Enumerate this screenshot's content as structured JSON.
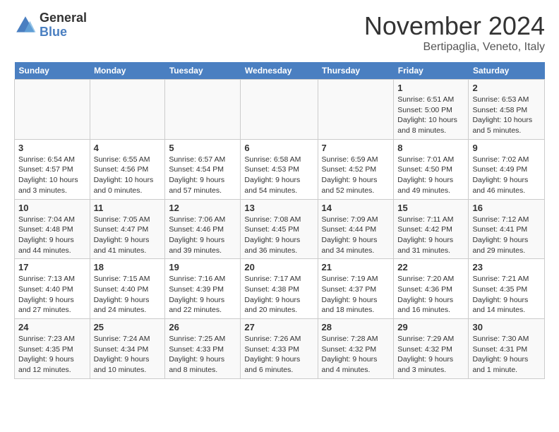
{
  "logo": {
    "general": "General",
    "blue": "Blue"
  },
  "header": {
    "month": "November 2024",
    "location": "Bertipaglia, Veneto, Italy"
  },
  "weekdays": [
    "Sunday",
    "Monday",
    "Tuesday",
    "Wednesday",
    "Thursday",
    "Friday",
    "Saturday"
  ],
  "weeks": [
    [
      {
        "day": "",
        "detail": ""
      },
      {
        "day": "",
        "detail": ""
      },
      {
        "day": "",
        "detail": ""
      },
      {
        "day": "",
        "detail": ""
      },
      {
        "day": "",
        "detail": ""
      },
      {
        "day": "1",
        "detail": "Sunrise: 6:51 AM\nSunset: 5:00 PM\nDaylight: 10 hours and 8 minutes."
      },
      {
        "day": "2",
        "detail": "Sunrise: 6:53 AM\nSunset: 4:58 PM\nDaylight: 10 hours and 5 minutes."
      }
    ],
    [
      {
        "day": "3",
        "detail": "Sunrise: 6:54 AM\nSunset: 4:57 PM\nDaylight: 10 hours and 3 minutes."
      },
      {
        "day": "4",
        "detail": "Sunrise: 6:55 AM\nSunset: 4:56 PM\nDaylight: 10 hours and 0 minutes."
      },
      {
        "day": "5",
        "detail": "Sunrise: 6:57 AM\nSunset: 4:54 PM\nDaylight: 9 hours and 57 minutes."
      },
      {
        "day": "6",
        "detail": "Sunrise: 6:58 AM\nSunset: 4:53 PM\nDaylight: 9 hours and 54 minutes."
      },
      {
        "day": "7",
        "detail": "Sunrise: 6:59 AM\nSunset: 4:52 PM\nDaylight: 9 hours and 52 minutes."
      },
      {
        "day": "8",
        "detail": "Sunrise: 7:01 AM\nSunset: 4:50 PM\nDaylight: 9 hours and 49 minutes."
      },
      {
        "day": "9",
        "detail": "Sunrise: 7:02 AM\nSunset: 4:49 PM\nDaylight: 9 hours and 46 minutes."
      }
    ],
    [
      {
        "day": "10",
        "detail": "Sunrise: 7:04 AM\nSunset: 4:48 PM\nDaylight: 9 hours and 44 minutes."
      },
      {
        "day": "11",
        "detail": "Sunrise: 7:05 AM\nSunset: 4:47 PM\nDaylight: 9 hours and 41 minutes."
      },
      {
        "day": "12",
        "detail": "Sunrise: 7:06 AM\nSunset: 4:46 PM\nDaylight: 9 hours and 39 minutes."
      },
      {
        "day": "13",
        "detail": "Sunrise: 7:08 AM\nSunset: 4:45 PM\nDaylight: 9 hours and 36 minutes."
      },
      {
        "day": "14",
        "detail": "Sunrise: 7:09 AM\nSunset: 4:44 PM\nDaylight: 9 hours and 34 minutes."
      },
      {
        "day": "15",
        "detail": "Sunrise: 7:11 AM\nSunset: 4:42 PM\nDaylight: 9 hours and 31 minutes."
      },
      {
        "day": "16",
        "detail": "Sunrise: 7:12 AM\nSunset: 4:41 PM\nDaylight: 9 hours and 29 minutes."
      }
    ],
    [
      {
        "day": "17",
        "detail": "Sunrise: 7:13 AM\nSunset: 4:40 PM\nDaylight: 9 hours and 27 minutes."
      },
      {
        "day": "18",
        "detail": "Sunrise: 7:15 AM\nSunset: 4:40 PM\nDaylight: 9 hours and 24 minutes."
      },
      {
        "day": "19",
        "detail": "Sunrise: 7:16 AM\nSunset: 4:39 PM\nDaylight: 9 hours and 22 minutes."
      },
      {
        "day": "20",
        "detail": "Sunrise: 7:17 AM\nSunset: 4:38 PM\nDaylight: 9 hours and 20 minutes."
      },
      {
        "day": "21",
        "detail": "Sunrise: 7:19 AM\nSunset: 4:37 PM\nDaylight: 9 hours and 18 minutes."
      },
      {
        "day": "22",
        "detail": "Sunrise: 7:20 AM\nSunset: 4:36 PM\nDaylight: 9 hours and 16 minutes."
      },
      {
        "day": "23",
        "detail": "Sunrise: 7:21 AM\nSunset: 4:35 PM\nDaylight: 9 hours and 14 minutes."
      }
    ],
    [
      {
        "day": "24",
        "detail": "Sunrise: 7:23 AM\nSunset: 4:35 PM\nDaylight: 9 hours and 12 minutes."
      },
      {
        "day": "25",
        "detail": "Sunrise: 7:24 AM\nSunset: 4:34 PM\nDaylight: 9 hours and 10 minutes."
      },
      {
        "day": "26",
        "detail": "Sunrise: 7:25 AM\nSunset: 4:33 PM\nDaylight: 9 hours and 8 minutes."
      },
      {
        "day": "27",
        "detail": "Sunrise: 7:26 AM\nSunset: 4:33 PM\nDaylight: 9 hours and 6 minutes."
      },
      {
        "day": "28",
        "detail": "Sunrise: 7:28 AM\nSunset: 4:32 PM\nDaylight: 9 hours and 4 minutes."
      },
      {
        "day": "29",
        "detail": "Sunrise: 7:29 AM\nSunset: 4:32 PM\nDaylight: 9 hours and 3 minutes."
      },
      {
        "day": "30",
        "detail": "Sunrise: 7:30 AM\nSunset: 4:31 PM\nDaylight: 9 hours and 1 minute."
      }
    ]
  ]
}
